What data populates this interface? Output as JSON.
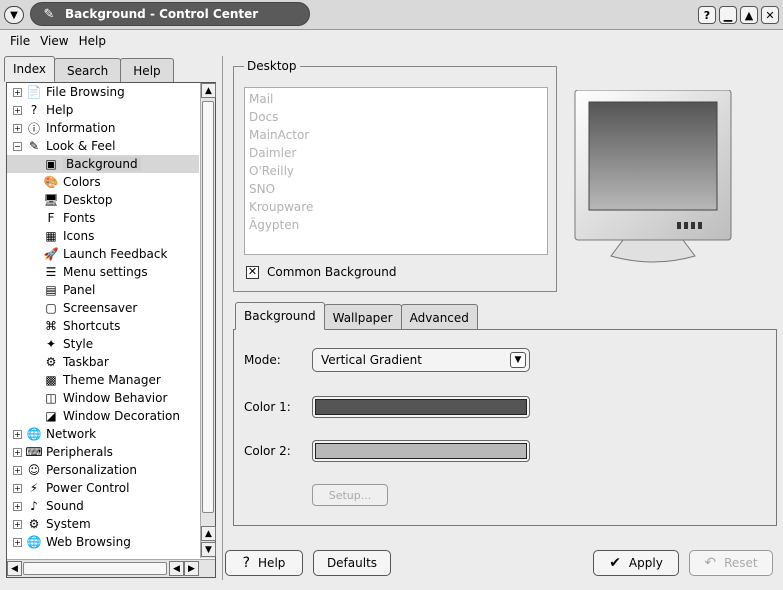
{
  "window": {
    "title": "Background - Control Center",
    "controls": [
      "help-icon",
      "minimize-icon",
      "maximize-icon",
      "close-icon"
    ]
  },
  "menubar": [
    "File",
    "View",
    "Help"
  ],
  "left_tabs": [
    "Index",
    "Search",
    "Help"
  ],
  "tree": [
    {
      "label": "File Browsing",
      "icon": "file-browsing-icon",
      "glyph": "📄",
      "exp": "+",
      "child": false
    },
    {
      "label": "Help",
      "icon": "help-icon",
      "glyph": "?",
      "exp": "+",
      "child": false
    },
    {
      "label": "Information",
      "icon": "information-icon",
      "glyph": "ⓘ",
      "exp": "+",
      "child": false
    },
    {
      "label": "Look & Feel",
      "icon": "look-and-feel-icon",
      "glyph": "✎",
      "exp": "−",
      "child": false
    },
    {
      "label": "Background",
      "icon": "background-icon",
      "glyph": "▣",
      "child": true,
      "selected": true
    },
    {
      "label": "Colors",
      "icon": "colors-icon",
      "glyph": "🎨",
      "child": true
    },
    {
      "label": "Desktop",
      "icon": "desktop-icon",
      "glyph": "🖥",
      "child": true
    },
    {
      "label": "Fonts",
      "icon": "fonts-icon",
      "glyph": "F",
      "child": true
    },
    {
      "label": "Icons",
      "icon": "icons-icon",
      "glyph": "▦",
      "child": true
    },
    {
      "label": "Launch Feedback",
      "icon": "launch-feedback-icon",
      "glyph": "🚀",
      "child": true
    },
    {
      "label": "Menu settings",
      "icon": "menu-settings-icon",
      "glyph": "☰",
      "child": true
    },
    {
      "label": "Panel",
      "icon": "panel-icon",
      "glyph": "▤",
      "child": true
    },
    {
      "label": "Screensaver",
      "icon": "screensaver-icon",
      "glyph": "▢",
      "child": true
    },
    {
      "label": "Shortcuts",
      "icon": "shortcuts-icon",
      "glyph": "⌘",
      "child": true
    },
    {
      "label": "Style",
      "icon": "style-icon",
      "glyph": "✦",
      "child": true
    },
    {
      "label": "Taskbar",
      "icon": "taskbar-icon",
      "glyph": "⚙",
      "child": true
    },
    {
      "label": "Theme Manager",
      "icon": "theme-manager-icon",
      "glyph": "▩",
      "child": true
    },
    {
      "label": "Window Behavior",
      "icon": "window-behavior-icon",
      "glyph": "◫",
      "child": true
    },
    {
      "label": "Window Decoration",
      "icon": "window-decoration-icon",
      "glyph": "◪",
      "child": true
    },
    {
      "label": "Network",
      "icon": "network-icon",
      "glyph": "🌐",
      "exp": "+",
      "child": false
    },
    {
      "label": "Peripherals",
      "icon": "peripherals-icon",
      "glyph": "⌨",
      "exp": "+",
      "child": false
    },
    {
      "label": "Personalization",
      "icon": "personalization-icon",
      "glyph": "☺",
      "exp": "+",
      "child": false
    },
    {
      "label": "Power Control",
      "icon": "power-control-icon",
      "glyph": "⚡",
      "exp": "+",
      "child": false
    },
    {
      "label": "Sound",
      "icon": "sound-icon",
      "glyph": "♪",
      "exp": "+",
      "child": false
    },
    {
      "label": "System",
      "icon": "system-icon",
      "glyph": "⚙",
      "exp": "+",
      "child": false
    },
    {
      "label": "Web Browsing",
      "icon": "web-browsing-icon",
      "glyph": "🌐",
      "exp": "+",
      "child": false
    }
  ],
  "desktop": {
    "group_label": "Desktop",
    "items": [
      "Mail",
      "Docs",
      "MainActor",
      "Daimler",
      "O'Reilly",
      "SNO",
      "Kroupware",
      "Ägypten"
    ],
    "common_background_label": "Common Background",
    "common_background_checked": true
  },
  "bg_tabs": [
    "Background",
    "Wallpaper",
    "Advanced"
  ],
  "background": {
    "mode_label": "Mode:",
    "mode_value": "Vertical Gradient",
    "color1_label": "Color 1:",
    "color1": "#555555",
    "color2_label": "Color 2:",
    "color2": "#b8b8b8",
    "setup_label": "Setup..."
  },
  "buttons": {
    "help": "Help",
    "defaults": "Defaults",
    "apply": "Apply",
    "reset": "Reset"
  }
}
